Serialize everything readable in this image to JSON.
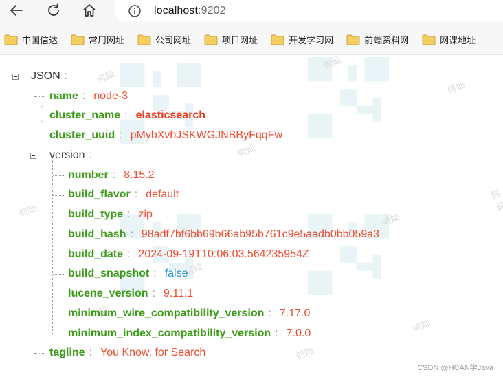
{
  "browser": {
    "url_host": "localhost",
    "url_port": ":9202",
    "icons": {
      "back": "arrow-left-icon",
      "reload": "reload-icon",
      "home": "home-icon",
      "info": "info-icon",
      "folder": "folder-icon"
    },
    "bookmarks": [
      "中国信达",
      "常用网址",
      "公司网址",
      "项目网址",
      "开发学习网",
      "前端资料网",
      "网课地址"
    ]
  },
  "json": {
    "root_key": "JSON",
    "name": {
      "key": "name",
      "value": "node-3"
    },
    "cluster_name": {
      "key": "cluster_name",
      "value": "elasticsearch"
    },
    "cluster_uuid": {
      "key": "cluster_uuid",
      "value": "pMybXvbJSKWGJNBByFqqFw"
    },
    "version": {
      "key": "version",
      "number": {
        "key": "number",
        "value": "8.15.2"
      },
      "build_flavor": {
        "key": "build_flavor",
        "value": "default"
      },
      "build_type": {
        "key": "build_type",
        "value": "zip"
      },
      "build_hash": {
        "key": "build_hash",
        "value": "98adf7bf6bb69b66ab95b761c9e5aadb0bb059a3"
      },
      "build_date": {
        "key": "build_date",
        "value": "2024-09-19T10:06:03.564235954Z"
      },
      "build_snapshot": {
        "key": "build_snapshot",
        "value": "false"
      },
      "lucene_version": {
        "key": "lucene_version",
        "value": "9.11.1"
      },
      "minimum_wire_compatibility_version": {
        "key": "minimum_wire_compatibility_version",
        "value": "7.17.0"
      },
      "minimum_index_compatibility_version": {
        "key": "minimum_index_compatibility_version",
        "value": "7.0.0"
      }
    },
    "tagline": {
      "key": "tagline",
      "value": "You Know, for Search"
    }
  },
  "watermark_text": "何灿",
  "credit": "CSDN @HCAN学Java",
  "colors": {
    "key": "#3a9b16",
    "string": "#f04a2d",
    "boolean": "#1e8fd6",
    "selection": "#5b8fd6"
  }
}
